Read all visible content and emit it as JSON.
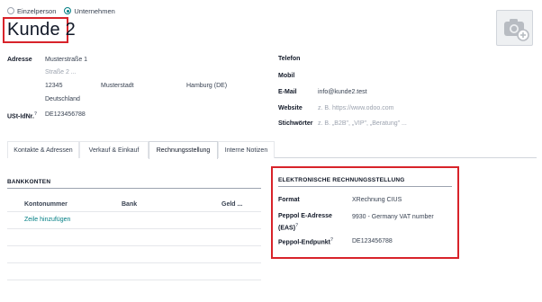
{
  "company_type": {
    "options": [
      "Einzelperson",
      "Unternehmen"
    ],
    "selected": "Unternehmen"
  },
  "name": "Kunde 2",
  "avatar_icon": "camera-plus-icon",
  "address": {
    "label": "Adresse",
    "street": "Musterstraße 1",
    "street2_placeholder": "Straße 2 ...",
    "zip": "12345",
    "city": "Musterstadt",
    "state": "Hamburg (DE)",
    "country": "Deutschland"
  },
  "vat": {
    "label": "USt-IdNr.",
    "value": "DE123456788"
  },
  "contact": {
    "phone_label": "Telefon",
    "mobile_label": "Mobil",
    "email_label": "E-Mail",
    "email_value": "info@kunde2.test",
    "website_label": "Website",
    "website_placeholder": "z. B. https://www.odoo.com",
    "tags_label": "Stichwörter",
    "tags_placeholder": "z. B. „B2B\", „VIP\", „Beratung\" ..."
  },
  "tabs": [
    {
      "label": "Kontakte & Adressen",
      "active": false
    },
    {
      "label": "Verkauf & Einkauf",
      "active": false
    },
    {
      "label": "Rechnungsstellung",
      "active": true
    },
    {
      "label": "Interne Notizen",
      "active": false
    }
  ],
  "bank_accounts": {
    "title": "BANKKONTEN",
    "columns": [
      "Kontonummer",
      "Bank",
      "Geld ..."
    ],
    "add_line": "Zeile hinzufügen"
  },
  "einvoicing": {
    "title": "ELEKTRONISCHE RECHNUNGSSTELLUNG",
    "format_label": "Format",
    "format_value": "XRechnung CIUS",
    "peppol_address_label": "Peppol E-Adresse (EAS)",
    "peppol_address_value": "9930 - Germany VAT number",
    "peppol_endpoint_label": "Peppol-Endpunkt",
    "peppol_endpoint_value": "DE123456788"
  },
  "colors": {
    "accent": "#017e84",
    "highlight": "#d8232a"
  }
}
